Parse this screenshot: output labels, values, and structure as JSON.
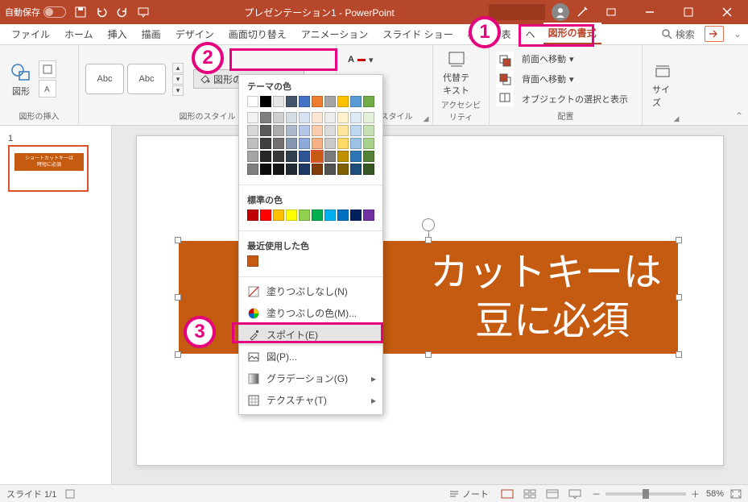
{
  "titlebar": {
    "autosave_label": "自動保存",
    "autosave_state": "オフ",
    "document_title": "プレゼンテーション1 - PowerPoint"
  },
  "tabs": {
    "file": "ファイル",
    "home": "ホーム",
    "insert": "挿入",
    "draw": "描画",
    "design": "デザイン",
    "transitions": "画面切り替え",
    "animations": "アニメーション",
    "slideshow": "スライド ショー",
    "review": "校閲",
    "view": "表",
    "help": "ヘ",
    "shape_format": "図形の書式",
    "search": "検索"
  },
  "ribbon": {
    "insert_shapes": {
      "shape_btn": "図形",
      "group_label": "図形の挿入"
    },
    "shape_styles": {
      "preview_text": "Abc",
      "fill_btn": "図形の塗りつぶし",
      "group_label": "図形のスタイル"
    },
    "wordart": {
      "group_label": "ートのスタイル"
    },
    "accessibility": {
      "alt_text": "代替テ\nキスト",
      "group_label": "アクセシビリティ"
    },
    "arrange": {
      "bring_forward": "前面へ移動",
      "send_backward": "背面へ移動",
      "selection_pane": "オブジェクトの選択と表示",
      "group_label": "配置"
    },
    "size": {
      "label": "サイズ"
    }
  },
  "dropdown": {
    "theme_colors_label": "テーマの色",
    "standard_colors_label": "標準の色",
    "recent_colors_label": "最近使用した色",
    "no_fill": "塗りつぶしなし(N)",
    "more_colors": "塗りつぶしの色(M)...",
    "eyedropper": "スポイト(E)",
    "picture": "図(P)...",
    "gradient": "グラデーション(G)",
    "texture": "テクスチャ(T)",
    "theme_top_row": [
      "#ffffff",
      "#000000",
      "#e7e6e6",
      "#44546a",
      "#4472c4",
      "#ed7d31",
      "#a5a5a5",
      "#ffc000",
      "#5b9bd5",
      "#70ad47"
    ],
    "theme_shades": [
      [
        "#f2f2f2",
        "#7f7f7f",
        "#d0cece",
        "#d6dce4",
        "#d9e2f3",
        "#fbe5d5",
        "#ededed",
        "#fff2cc",
        "#deebf6",
        "#e2efd9"
      ],
      [
        "#d8d8d8",
        "#595959",
        "#aeabab",
        "#adb9ca",
        "#b4c6e7",
        "#f7cbac",
        "#dbdbdb",
        "#fee599",
        "#bdd7ee",
        "#c5e0b3"
      ],
      [
        "#bfbfbf",
        "#3f3f3f",
        "#757070",
        "#8496b0",
        "#8eaadb",
        "#f4b183",
        "#c9c9c9",
        "#ffd965",
        "#9cc3e5",
        "#a8d08d"
      ],
      [
        "#a5a5a5",
        "#262626",
        "#3a3838",
        "#323f4f",
        "#2f5496",
        "#c55a11",
        "#7b7b7b",
        "#bf9000",
        "#2e75b5",
        "#538135"
      ],
      [
        "#7f7f7f",
        "#0c0c0c",
        "#171616",
        "#222a35",
        "#1f3864",
        "#833c0b",
        "#525252",
        "#7f6000",
        "#1e4e79",
        "#375623"
      ]
    ],
    "standard_colors": [
      "#c00000",
      "#ff0000",
      "#ffc000",
      "#ffff00",
      "#92d050",
      "#00b050",
      "#00b0f0",
      "#0070c0",
      "#002060",
      "#7030a0"
    ],
    "recent_colors": [
      "#c55a11"
    ],
    "selected_theme_index": {
      "row": 3,
      "col": 5
    }
  },
  "slide": {
    "shape_line1": "ショートカットキーは",
    "shape_line2": "時短に必須",
    "shape_color": "#c55a11",
    "text_visible_right_line1": "カットキーは",
    "text_visible_right_line2": "豆に必須"
  },
  "thumbnail": {
    "number": "1",
    "shape_text_l1": "ショートカットキーは",
    "shape_text_l2": "時短に必須"
  },
  "statusbar": {
    "slide_indicator": "スライド 1/1",
    "notes": "ノート",
    "zoom": "58%"
  },
  "annotations": {
    "c1": "1",
    "c2": "2",
    "c3": "3"
  }
}
